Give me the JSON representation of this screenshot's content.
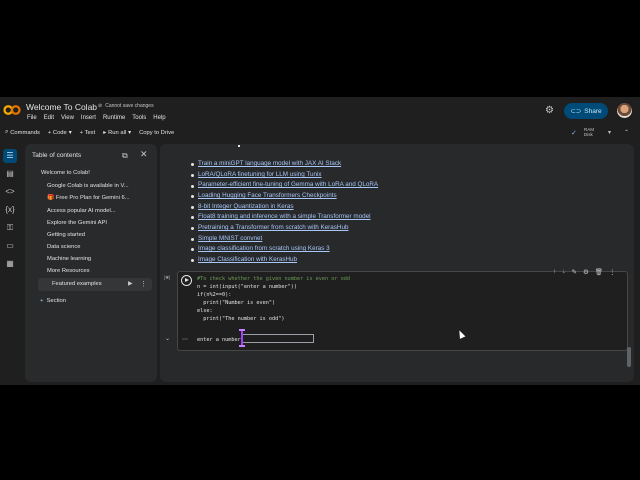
{
  "header": {
    "app_title": "Welcome To Colab",
    "save_warning": "Cannot save changes",
    "menus": [
      "File",
      "Edit",
      "View",
      "Insert",
      "Runtime",
      "Tools",
      "Help"
    ],
    "share_label": "Share"
  },
  "toolbar": {
    "commands": "Commands",
    "code": "+ Code",
    "text": "+ Text",
    "run_all": "Run all",
    "copy_drive": "Copy to Drive",
    "ram": "RAM",
    "disk": "Disk"
  },
  "toc": {
    "title": "Table of contents",
    "items": [
      "Welcome to Colab!",
      "Google Colab is available in V...",
      "🎁 Free Pro Plan for Gemini 6...",
      "Access popular AI model...",
      "Explore the Gemini API",
      "Getting started",
      "Data science",
      "Machine learning",
      "More Resources",
      "Featured examples",
      "Section"
    ]
  },
  "links": [
    "Train a miniGPT language model with JAX AI Stack",
    "LoRA/QLoRA finetuning for LLM using Tunix",
    "Parameter-efficient fine-tuning of Gemma with LoRA and QLoRA",
    "Loading Hugging Face Transformers Checkpoints",
    "8-bit Integer Quantization in Keras",
    "Float8 training and inference with a simple Transformer model",
    "Pretraining a Transformer from scratch with KerasHub",
    "Simple MNIST convnet",
    "Image classification from scratch using Keras 3",
    "Image Classification with KerasHub"
  ],
  "cell": {
    "count": "[✱]",
    "code_lines": [
      "#To check whether the given number is even or odd",
      "n = int(input(\"enter a number\"))",
      "if(n%2==0):",
      "  print(\"Number is even\")",
      "else:",
      "  print(\"The number is odd\")"
    ],
    "output_prompt": "enter a number",
    "input_value": ""
  },
  "colors": {
    "bg": "#1f1f1f",
    "panel": "#28292b",
    "link": "#a8c7fa",
    "share_bg": "#004a77",
    "comment": "#6a9955"
  },
  "icons": [
    "colab-logo-icon",
    "gear-icon",
    "lock-icon",
    "search-icon",
    "toc-icon",
    "doc-icon",
    "code-icon",
    "variables-icon",
    "secrets-icon",
    "files-icon",
    "terminal-icon"
  ]
}
